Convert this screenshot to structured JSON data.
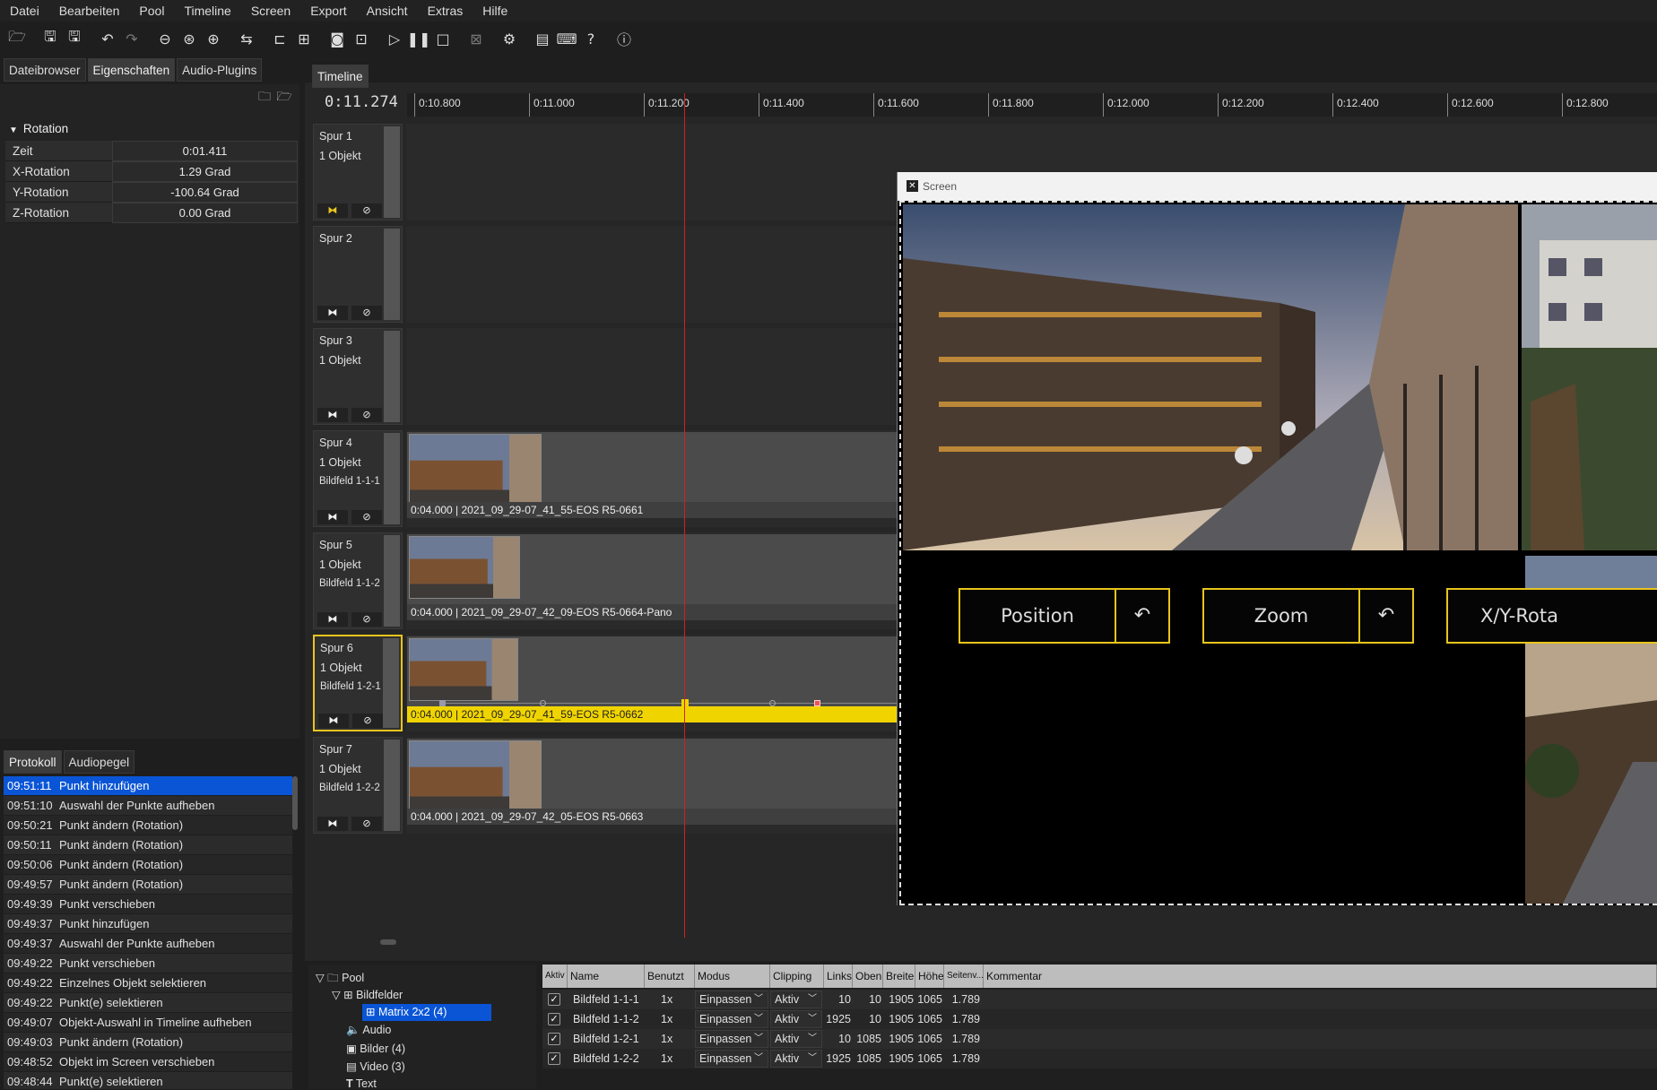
{
  "menu": [
    "Datei",
    "Bearbeiten",
    "Pool",
    "Timeline",
    "Screen",
    "Export",
    "Ansicht",
    "Extras",
    "Hilfe"
  ],
  "toolbar": {
    "icons": [
      "open-folder-icon",
      "save-icon",
      "save-all-icon",
      "undo-icon",
      "redo-icon",
      "zoom-out-icon",
      "zoom-fit-icon",
      "zoom-in-icon",
      "swap-icon",
      "magnet-icon",
      "grid-icon",
      "preview-icon",
      "screen-mode-icon",
      "play-icon",
      "pause-icon",
      "stop-icon",
      "close-screen-icon",
      "settings-icon",
      "comment-icon",
      "keyboard-icon",
      "help-icon",
      "info-icon"
    ]
  },
  "left_tabs": [
    "Dateibrowser",
    "Eigenschaften",
    "Audio-Plugins"
  ],
  "properties": {
    "section": "Rotation",
    "rows": [
      {
        "key": "Zeit",
        "value": "0:01.411"
      },
      {
        "key": "X-Rotation",
        "value": "1.29 Grad"
      },
      {
        "key": "Y-Rotation",
        "value": "-100.64 Grad"
      },
      {
        "key": "Z-Rotation",
        "value": "0.00 Grad"
      }
    ]
  },
  "log_tabs": [
    "Protokoll",
    "Audiopegel"
  ],
  "log": [
    {
      "time": "09:51:11",
      "text": "Punkt hinzufügen",
      "selected": true
    },
    {
      "time": "09:51:10",
      "text": "Auswahl der Punkte aufheben"
    },
    {
      "time": "09:50:21",
      "text": "Punkt ändern (Rotation)"
    },
    {
      "time": "09:50:11",
      "text": "Punkt ändern (Rotation)"
    },
    {
      "time": "09:50:06",
      "text": "Punkt ändern (Rotation)"
    },
    {
      "time": "09:49:57",
      "text": "Punkt ändern (Rotation)"
    },
    {
      "time": "09:49:39",
      "text": "Punkt verschieben"
    },
    {
      "time": "09:49:37",
      "text": "Punkt hinzufügen"
    },
    {
      "time": "09:49:37",
      "text": "Auswahl der Punkte aufheben"
    },
    {
      "time": "09:49:22",
      "text": "Punkt verschieben"
    },
    {
      "time": "09:49:22",
      "text": "Einzelnes Objekt selektieren"
    },
    {
      "time": "09:49:22",
      "text": "Punkt(e) selektieren"
    },
    {
      "time": "09:49:07",
      "text": "Objekt-Auswahl in Timeline aufheben"
    },
    {
      "time": "09:49:03",
      "text": "Punkt ändern (Rotation)"
    },
    {
      "time": "09:48:52",
      "text": "Objekt im Screen verschieben"
    },
    {
      "time": "09:48:44",
      "text": "Punkt(e) selektieren"
    }
  ],
  "timeline": {
    "tab": "Timeline",
    "timecode": "0:11.274",
    "ticks": [
      "0:10.800",
      "0:11.000",
      "0:11.200",
      "0:11.400",
      "0:11.600",
      "0:11.800",
      "0:12.000",
      "0:12.200",
      "0:12.400",
      "0:12.600",
      "0:12.800"
    ],
    "tracks": [
      {
        "name": "Spur 1",
        "objects": "1 Objekt",
        "field": ""
      },
      {
        "name": "Spur 2",
        "objects": "",
        "field": ""
      },
      {
        "name": "Spur 3",
        "objects": "1 Objekt",
        "field": ""
      },
      {
        "name": "Spur 4",
        "objects": "1 Objekt",
        "field": "Bildfeld 1-1-1",
        "clip": "0:04.000  |  2021_09_29-07_41_55-EOS R5-0661"
      },
      {
        "name": "Spur 5",
        "objects": "1 Objekt",
        "field": "Bildfeld 1-1-2",
        "clip": "0:04.000  |  2021_09_29-07_42_09-EOS R5-0664-Pano"
      },
      {
        "name": "Spur 6",
        "objects": "1 Objekt",
        "field": "Bildfeld 1-2-1",
        "clip": "0:04.000  |  2021_09_29-07_41_59-EOS R5-0662"
      },
      {
        "name": "Spur 7",
        "objects": "1 Objekt",
        "field": "Bildfeld 1-2-2",
        "clip": "0:04.000  |  2021_09_29-07_42_05-EOS R5-0663"
      }
    ]
  },
  "screen": {
    "title": "Screen",
    "controls": [
      "Position",
      "Zoom",
      "X/Y-Rota"
    ]
  },
  "pool": {
    "root": "Pool",
    "bildfelder": "Bildfelder",
    "matrix": "Matrix 2x2 (4)",
    "audio": "Audio",
    "bilder": "Bilder (4)",
    "video": "Video (3)",
    "text": "Text"
  },
  "grid": {
    "headers": [
      "Aktiv",
      "Name",
      "Benutzt",
      "Modus",
      "Clipping",
      "Links",
      "Oben",
      "Breite",
      "Höhe",
      "Seitenv...",
      "Kommentar"
    ],
    "rows": [
      {
        "name": "Bildfeld 1-1-1",
        "used": "1x",
        "mode": "Einpassen",
        "clip": "Aktiv",
        "left": "10",
        "top": "10",
        "width": "1905",
        "height": "1065",
        "ratio": "1.789"
      },
      {
        "name": "Bildfeld 1-1-2",
        "used": "1x",
        "mode": "Einpassen",
        "clip": "Aktiv",
        "left": "1925",
        "top": "10",
        "width": "1905",
        "height": "1065",
        "ratio": "1.789"
      },
      {
        "name": "Bildfeld 1-2-1",
        "used": "1x",
        "mode": "Einpassen",
        "clip": "Aktiv",
        "left": "10",
        "top": "1085",
        "width": "1905",
        "height": "1065",
        "ratio": "1.789"
      },
      {
        "name": "Bildfeld 1-2-2",
        "used": "1x",
        "mode": "Einpassen",
        "clip": "Aktiv",
        "left": "1925",
        "top": "1085",
        "width": "1905",
        "height": "1065",
        "ratio": "1.789"
      }
    ]
  }
}
